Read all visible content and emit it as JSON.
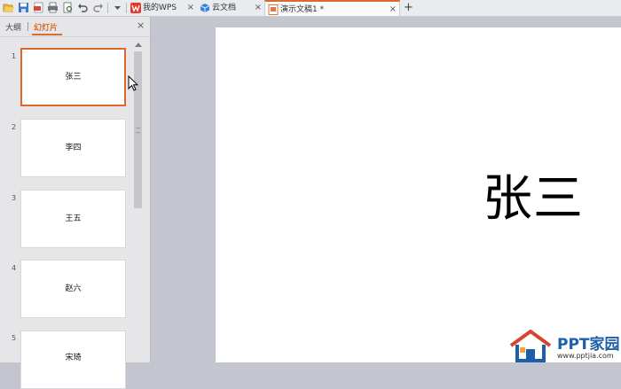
{
  "titlebar": {
    "tabs": [
      {
        "label": "我的WPS",
        "close": "×"
      },
      {
        "label": "云文档",
        "close": "×"
      },
      {
        "label": "演示文稿1 *",
        "close": "×"
      }
    ],
    "add_tab": "+"
  },
  "left_pane": {
    "tab_outline": "大纲",
    "tab_slides": "幻灯片",
    "close": "×",
    "slides": [
      {
        "number": "1",
        "text": "张三"
      },
      {
        "number": "2",
        "text": "李四"
      },
      {
        "number": "3",
        "text": "王五"
      },
      {
        "number": "4",
        "text": "赵六"
      },
      {
        "number": "5",
        "text": "宋琦"
      }
    ]
  },
  "slide": {
    "title": "张三"
  },
  "watermark": {
    "brand": "PPT家园",
    "url": "www.pptjia.com"
  },
  "colors": {
    "accent": "#d76c2c",
    "selected_border": "#e0662a",
    "brand_blue": "#1d5fa8"
  }
}
